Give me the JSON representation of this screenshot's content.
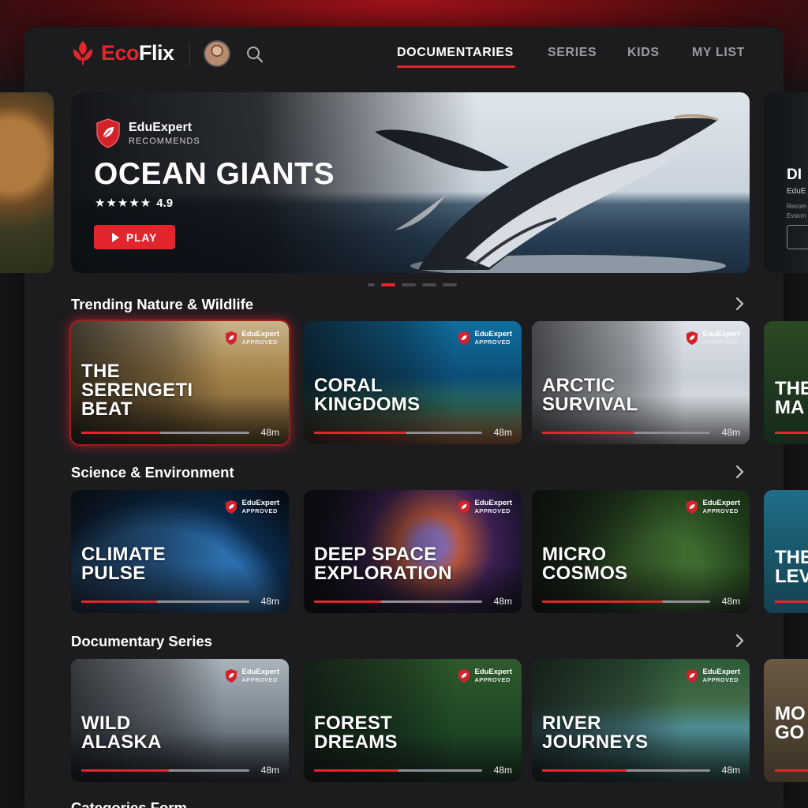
{
  "app": {
    "name_part1": "Eco",
    "name_part2": "Flix",
    "brand_color": "#e3262e"
  },
  "header": {
    "nav": [
      {
        "label": "DOCUMENTARIES",
        "active": true
      },
      {
        "label": "SERIES",
        "active": false
      },
      {
        "label": "KIDS",
        "active": false
      },
      {
        "label": "MY LIST",
        "active": false
      }
    ],
    "icons": [
      "leaf-logo-icon",
      "avatar",
      "search-icon"
    ]
  },
  "hero": {
    "badge_name": "EduExpert",
    "badge_sub": "RECOMMENDS",
    "title": "OCEAN GIANTS",
    "stars": "★★★★★",
    "rating": "4.9",
    "play_label": "PLAY",
    "carousel_dots": 5,
    "active_dot": 1,
    "next_peek": {
      "title": "DI",
      "badge": "EduE",
      "line1": "Recom",
      "line2": "Evocm"
    }
  },
  "rows": [
    {
      "title": "Trending Nature & Wildlife",
      "cards": [
        {
          "title": "THE\nSERENGETI\nBEAT",
          "badge_name": "EduExpert",
          "badge_sub": "APPROVED",
          "duration": "48m",
          "progress": 0.47
        },
        {
          "title": "CORAL\nKINGDOMS",
          "badge_name": "EduExpert",
          "badge_sub": "APPROVED",
          "duration": "48m",
          "progress": 0.55
        },
        {
          "title": "ARCTIC\nSURVIVAL",
          "badge_name": "EduExpert",
          "badge_sub": "APPROVED",
          "duration": "48m",
          "progress": 0.55
        }
      ],
      "peek": "THE\nMA"
    },
    {
      "title": "Science & Environment",
      "cards": [
        {
          "title": "CLIMATE\nPULSE",
          "badge_name": "EduExpert",
          "badge_sub": "APPROVED",
          "duration": "48m",
          "progress": 0.45
        },
        {
          "title": "DEEP SPACE\nEXPLORATION",
          "badge_name": "EduExpert",
          "badge_sub": "APPROVED",
          "duration": "48m",
          "progress": 0.4
        },
        {
          "title": "MICRO\nCOSMOS",
          "badge_name": "EduExpert",
          "badge_sub": "APPROVED",
          "duration": "48m",
          "progress": 0.72
        }
      ],
      "peek": "THE\nLEV"
    },
    {
      "title": "Documentary Series",
      "cards": [
        {
          "title": "WILD\nALASKA",
          "badge_name": "EduExpert",
          "badge_sub": "APPROVED",
          "duration": "48m",
          "progress": 0.52
        },
        {
          "title": "FOREST\nDREAMS",
          "badge_name": "EduExpert",
          "badge_sub": "APPROVED",
          "duration": "48m",
          "progress": 0.5
        },
        {
          "title": "RIVER\nJOURNEYS",
          "badge_name": "EduExpert",
          "badge_sub": "APPROVED",
          "duration": "48m",
          "progress": 0.5
        }
      ],
      "peek": "MO\nGO"
    }
  ],
  "bottom_row_title": "Categories Form"
}
